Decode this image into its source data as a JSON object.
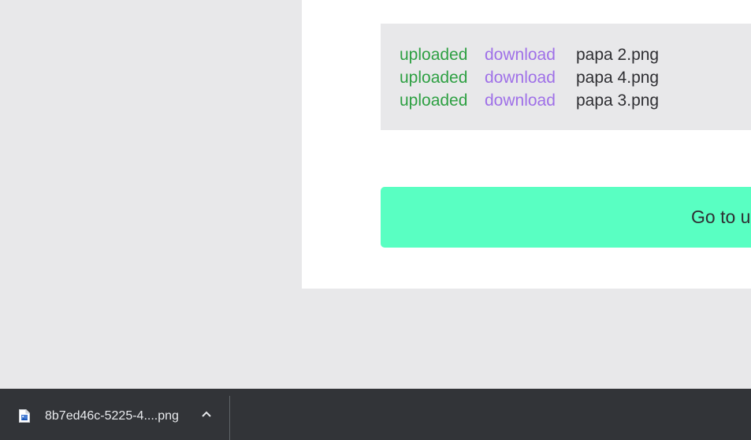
{
  "files": [
    {
      "status": "uploaded",
      "action": "download",
      "name": "papa 2.png"
    },
    {
      "status": "uploaded",
      "action": "download",
      "name": "papa 4.png"
    },
    {
      "status": "uploaded",
      "action": "download",
      "name": "papa 3.png"
    }
  ],
  "upload_button": {
    "label": "Go to u"
  },
  "download_bar": {
    "item": {
      "filename": "8b7ed46c-5225-4....png",
      "icon": "image-file-icon"
    },
    "chevron_icon": "chevron-up-icon"
  },
  "colors": {
    "status": "#2ea043",
    "download_link": "#9f70e8",
    "button_bg": "#59ffc2",
    "bar_bg": "#323438"
  }
}
